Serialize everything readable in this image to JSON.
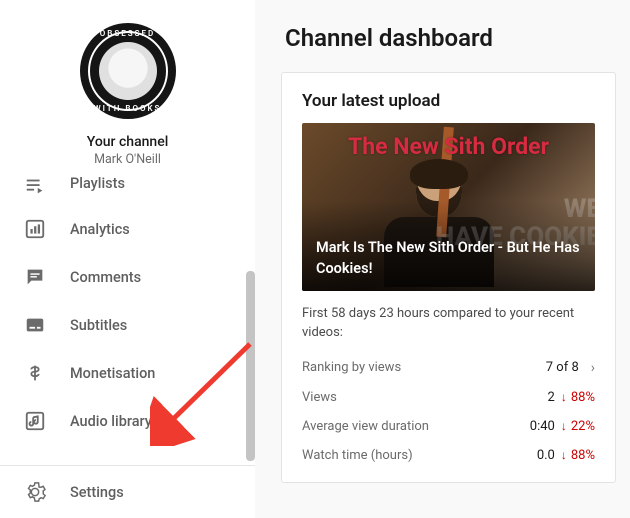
{
  "sidebar": {
    "avatar": {
      "top_text": "OBSESSED",
      "bottom_text": "WITH BOOKS"
    },
    "your_channel_label": "Your channel",
    "owner_name": "Mark O'Neill",
    "items": [
      {
        "icon": "playlist-icon",
        "label": "Playlists"
      },
      {
        "icon": "analytics-icon",
        "label": "Analytics"
      },
      {
        "icon": "comments-icon",
        "label": "Comments"
      },
      {
        "icon": "subtitles-icon",
        "label": "Subtitles"
      },
      {
        "icon": "monetise-icon",
        "label": "Monetisation"
      },
      {
        "icon": "audio-icon",
        "label": "Audio library"
      }
    ],
    "footer": {
      "icon": "gear-icon",
      "label": "Settings"
    }
  },
  "main": {
    "title": "Channel dashboard",
    "card": {
      "heading": "Your latest upload",
      "thumb_title": "The New Sith Order",
      "thumb_bg_text": "WE\nHAVE COOKIE",
      "caption": "Mark Is The New Sith Order - But He Has Cookies!",
      "compare_text": "First 58 days 23 hours compared to your recent videos:",
      "stats": [
        {
          "label": "Ranking by views",
          "value": "7 of 8",
          "delta": "",
          "chevron": true
        },
        {
          "label": "Views",
          "value": "2",
          "delta": "88%",
          "chevron": false
        },
        {
          "label": "Average view duration",
          "value": "0:40",
          "delta": "22%",
          "chevron": false
        },
        {
          "label": "Watch time (hours)",
          "value": "0.0",
          "delta": "88%",
          "chevron": false
        }
      ]
    }
  }
}
